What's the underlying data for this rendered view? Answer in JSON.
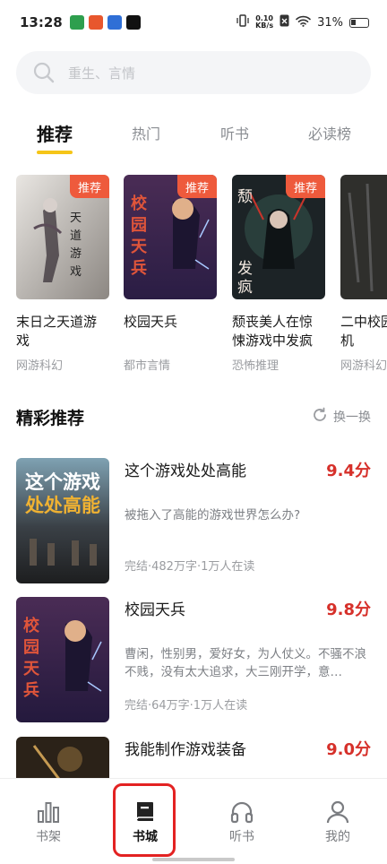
{
  "status_bar": {
    "time": "13:28",
    "net_speed_value": "0.10",
    "net_speed_unit": "KB/s",
    "battery": "31%"
  },
  "search": {
    "placeholder": "重生、言情"
  },
  "tabs": [
    {
      "label": "推荐"
    },
    {
      "label": "热门"
    },
    {
      "label": "听书"
    },
    {
      "label": "必读榜"
    }
  ],
  "books": [
    {
      "title": "末日之天道游戏",
      "genre": "网游科幻",
      "badge": "推荐",
      "cover_text": "天道游戏"
    },
    {
      "title": "校园天兵",
      "genre": "都市言情",
      "badge": "推荐",
      "cover_text": "校园天兵"
    },
    {
      "title": "颓丧美人在惊悚游戏中发疯",
      "genre": "恐怖推理",
      "badge": "推荐",
      "cover_text": "颓丧发疯"
    },
    {
      "title": "二中校园尸危机",
      "genre": "网游科幻",
      "badge": "",
      "cover_text": ""
    }
  ],
  "section": {
    "title": "精彩推荐",
    "refresh_label": "换一换"
  },
  "recommendations": [
    {
      "title": "这个游戏处处高能",
      "score": "9.4分",
      "desc": "被拖入了高能的游戏世界怎么办?",
      "meta": "完结·482万字·1万人在读",
      "cover_text": "这个游戏处处高能"
    },
    {
      "title": "校园天兵",
      "score": "9.8分",
      "desc": "曹闲，性别男，爱好女，为人仗义。不骚不浪不贱，没有太大追求，大三刚开学，意…",
      "meta": "完结·64万字·1万人在读",
      "cover_text": "校园天兵"
    },
    {
      "title": "我能制作游戏装备",
      "score": "9.0分",
      "desc": "",
      "meta": "",
      "cover_text": ""
    }
  ],
  "bottom_nav": [
    {
      "label": "书架",
      "icon": "bookshelf-icon"
    },
    {
      "label": "书城",
      "icon": "book-icon"
    },
    {
      "label": "听书",
      "icon": "headphones-icon"
    },
    {
      "label": "我的",
      "icon": "user-icon"
    }
  ],
  "colors": {
    "accent": "#f5c518",
    "badge": "#ee5a3c",
    "score": "#d6302a",
    "highlight": "#e32222"
  }
}
